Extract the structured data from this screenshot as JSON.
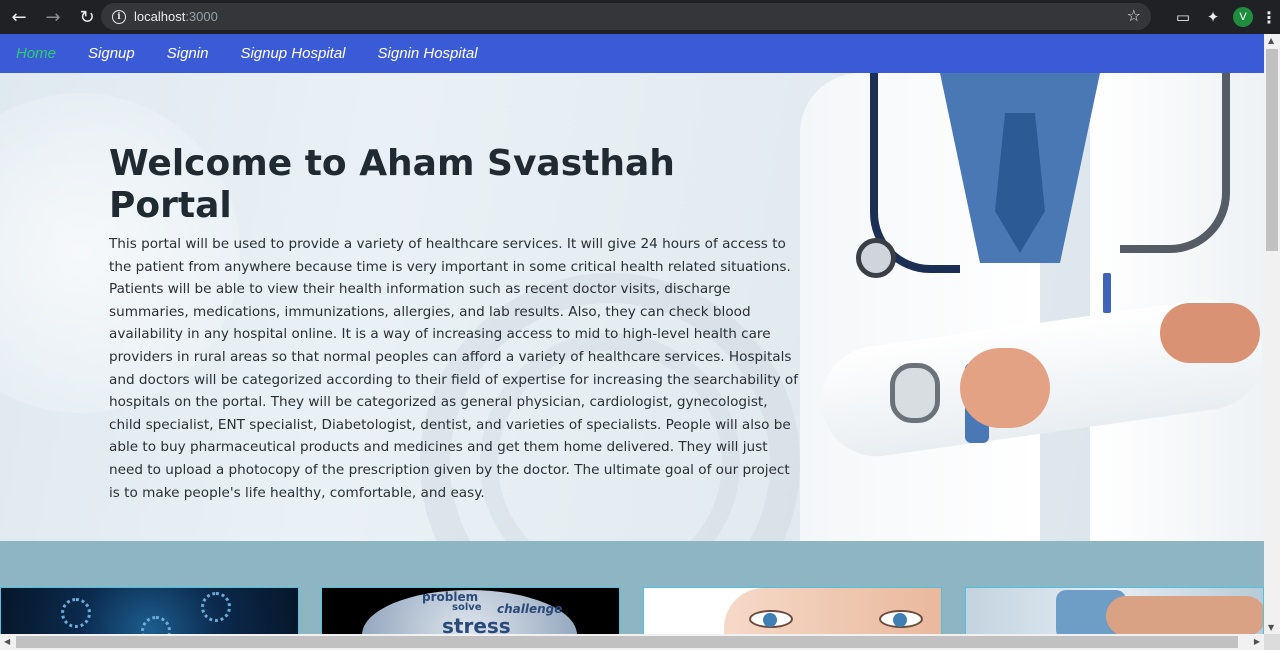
{
  "browser": {
    "url_host": "localhost",
    "url_port": ":3000",
    "profile_initial": "V",
    "icons": [
      "back-icon",
      "forward-icon",
      "reload-icon",
      "info-icon",
      "star-icon",
      "extension-icon",
      "puzzle-icon",
      "menu-icon"
    ]
  },
  "nav": {
    "items": [
      {
        "label": "Home",
        "active": true
      },
      {
        "label": "Signup",
        "active": false
      },
      {
        "label": "Signin",
        "active": false
      },
      {
        "label": "Signup Hospital",
        "active": false
      },
      {
        "label": "Signin Hospital",
        "active": false
      }
    ]
  },
  "hero": {
    "title": "Welcome to Aham Svasthah Portal",
    "body": "This portal will be used to provide a variety of healthcare services. It will give 24 hours of access to the patient from anywhere because time is very important in some critical health related situations. Patients will be able to view their health information such as recent doctor visits, discharge summaries, medications, immunizations, allergies, and lab results. Also, they can check blood availability in any hospital online. It is a way of increasing access to mid to high-level health care providers in rural areas so that normal peoples can afford a variety of healthcare services. Hospitals and doctors will be categorized according to their field of expertise for increasing the searchability of hospitals on the portal. They will be categorized as general physician, cardiologist, gynecologist, child specialist, ENT specialist, Diabetologist, dentist, and varieties of specialists. People will also be able to buy pharmaceutical products and medicines and get them home delivered. They will just need to upload a photocopy of the prescription given by the doctor. The ultimate goal of our project is to make people's life healthy, comfortable, and easy."
  },
  "cards": {
    "card2_words": [
      "problem",
      "solve",
      "challenge",
      "stress"
    ]
  },
  "colors": {
    "nav_bg": "#3b5bd6",
    "nav_active": "#2ecc71",
    "cards_bg": "#8db5c2",
    "card_border": "#4ec2e0"
  }
}
